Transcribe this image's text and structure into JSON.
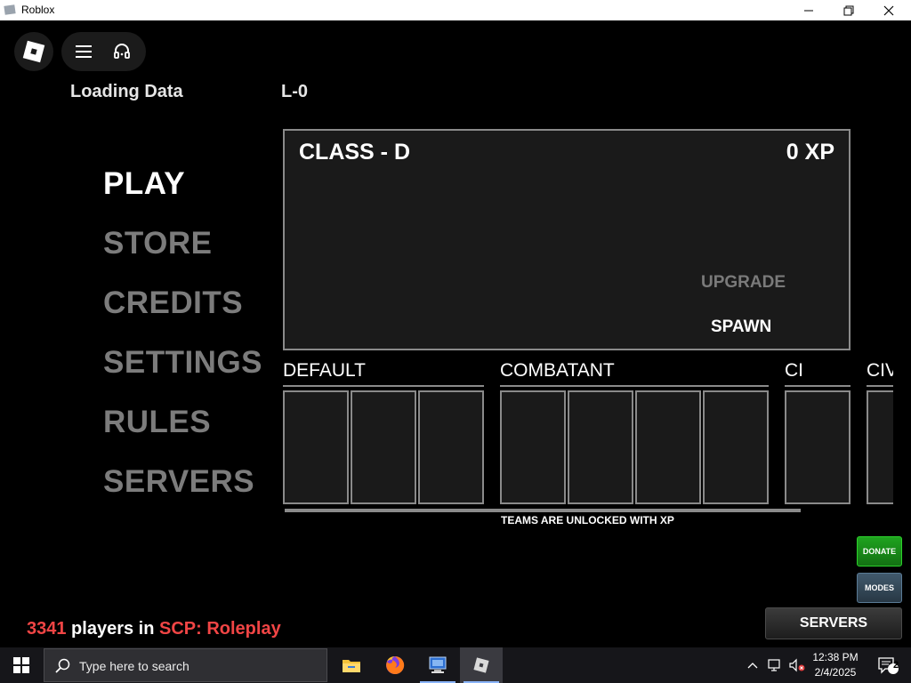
{
  "window": {
    "title": "Roblox"
  },
  "header": {
    "loading_text": "Loading Data",
    "level_text": "L-0"
  },
  "menu": {
    "items": [
      {
        "label": "PLAY",
        "active": true
      },
      {
        "label": "STORE",
        "active": false
      },
      {
        "label": "CREDITS",
        "active": false
      },
      {
        "label": "SETTINGS",
        "active": false
      },
      {
        "label": "RULES",
        "active": false
      },
      {
        "label": "SERVERS",
        "active": false
      }
    ]
  },
  "class_panel": {
    "class_name": "CLASS - D",
    "xp": "0 XP",
    "upgrade_label": "UPGRADE",
    "spawn_label": "SPAWN"
  },
  "teams": {
    "groups": [
      {
        "label": "DEFAULT",
        "slots": 3
      },
      {
        "label": "COMBATANT",
        "slots": 4
      },
      {
        "label": "CI",
        "slots": 1
      },
      {
        "label": "CIV",
        "slots": 1
      }
    ],
    "hint": "TEAMS ARE UNLOCKED WITH XP"
  },
  "buttons": {
    "donate": "DONATE",
    "modes": "MODES",
    "servers": "SERVERS"
  },
  "status": {
    "player_count": "3341",
    "players_text": " players in ",
    "game_name": "SCP: Roleplay"
  },
  "taskbar": {
    "search_placeholder": "Type here to search",
    "time": "12:38 PM",
    "date": "2/4/2025",
    "notification_count": "2"
  },
  "colors": {
    "accent_red": "#f14545",
    "donate_green": "#1fa31f",
    "modes_blue": "#41596c"
  }
}
